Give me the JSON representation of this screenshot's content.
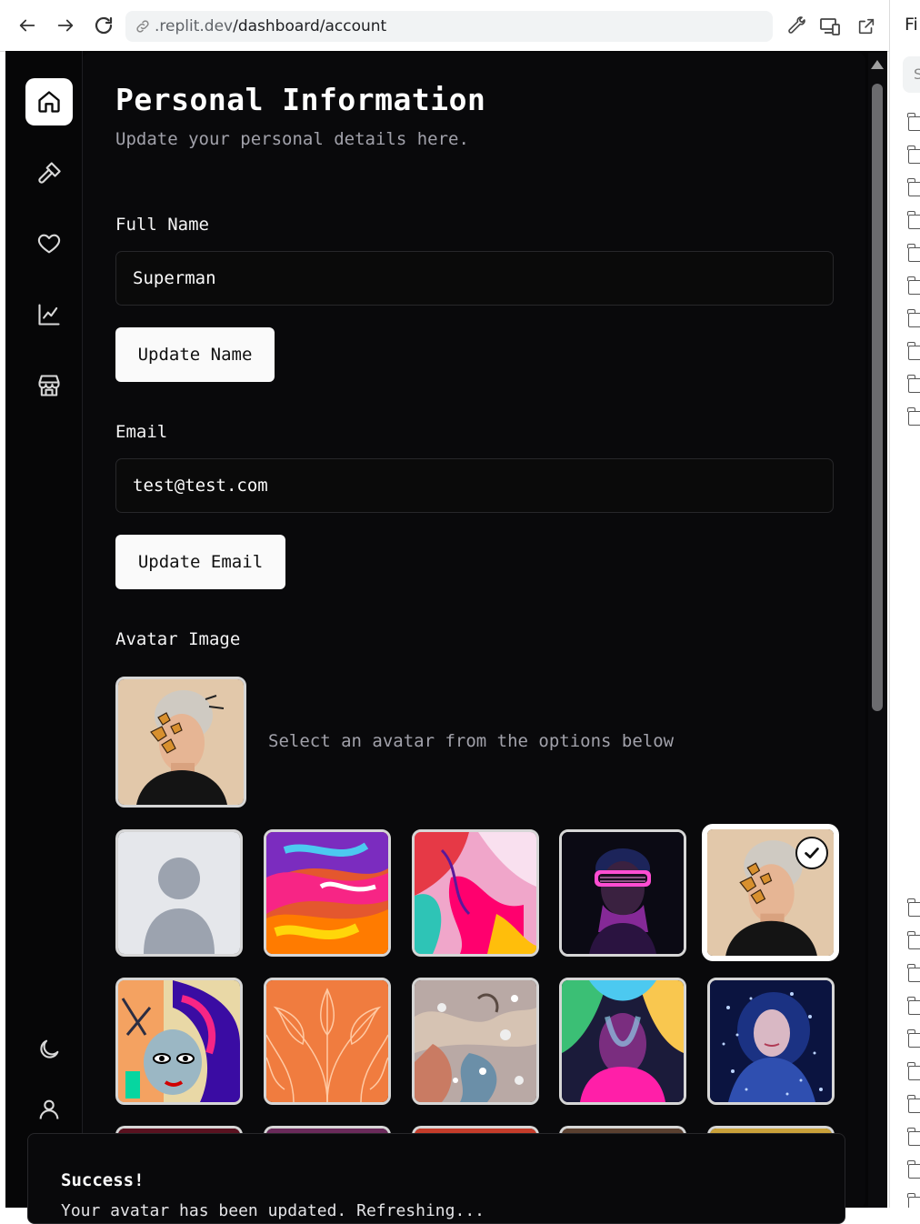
{
  "browser": {
    "url_host": ".replit.dev",
    "url_path": "/dashboard/account"
  },
  "side_panel": {
    "title": "Fi",
    "search_placeholder": "S"
  },
  "page": {
    "title": "Personal Information",
    "subtitle": "Update your personal details here."
  },
  "form": {
    "full_name_label": "Full Name",
    "full_name_value": "Superman",
    "update_name_button": "Update Name",
    "email_label": "Email",
    "email_value": "test@test.com",
    "update_email_button": "Update Email",
    "avatar_label": "Avatar Image",
    "avatar_hint": "Select an avatar from the options below"
  },
  "avatars": {
    "selected_index": 4,
    "options": [
      {
        "name": "avatar-default-silhouette"
      },
      {
        "name": "avatar-paint-splash"
      },
      {
        "name": "avatar-fluid-art"
      },
      {
        "name": "avatar-neon-shades"
      },
      {
        "name": "avatar-butterfly-face"
      },
      {
        "name": "avatar-graffiti-face"
      },
      {
        "name": "avatar-orange-leaves"
      },
      {
        "name": "avatar-metal-droplets"
      },
      {
        "name": "avatar-rainbow-smoke"
      },
      {
        "name": "avatar-blue-particles"
      }
    ]
  },
  "sidebar": {
    "items": [
      {
        "icon": "home-icon",
        "active": true
      },
      {
        "icon": "hammer-icon",
        "active": false
      },
      {
        "icon": "heart-icon",
        "active": false
      },
      {
        "icon": "chart-icon",
        "active": false
      },
      {
        "icon": "store-icon",
        "active": false
      }
    ],
    "bottom": [
      {
        "icon": "moon-icon"
      },
      {
        "icon": "user-icon"
      }
    ]
  },
  "toast": {
    "title": "Success!",
    "message": "Your avatar has been updated. Refreshing..."
  },
  "colors": {
    "app_bg": "#09090b",
    "button_bg": "#fafafa",
    "border": "#27272a",
    "muted_text": "#a1a1aa"
  }
}
